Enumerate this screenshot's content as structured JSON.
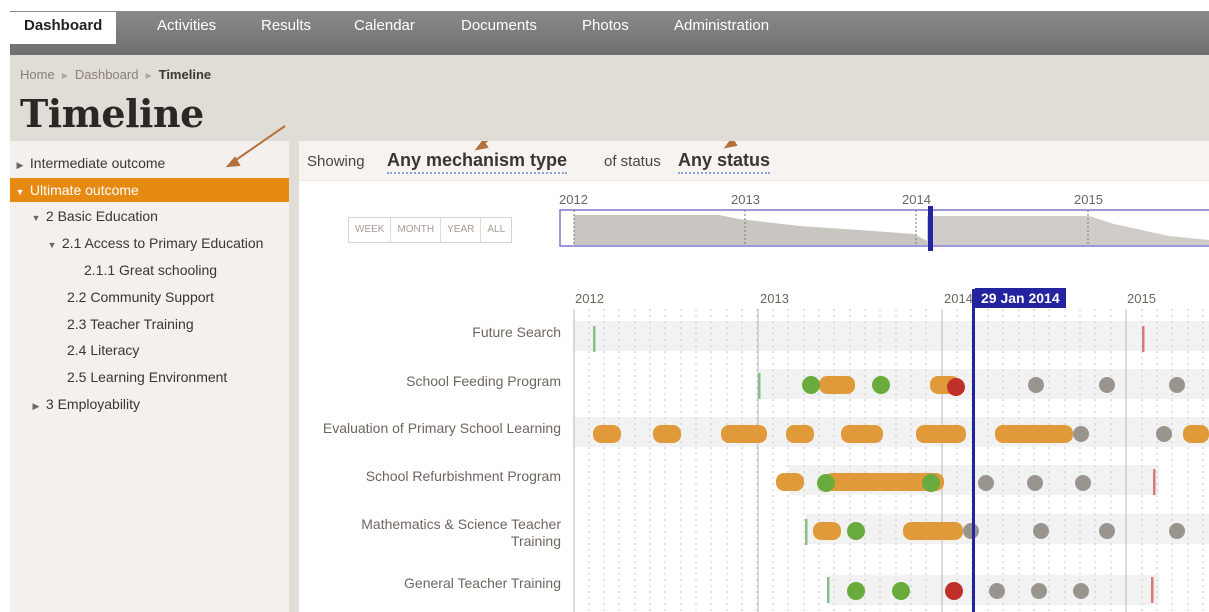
{
  "nav": {
    "tabs": [
      {
        "label": "Dashboard",
        "active": true
      },
      {
        "label": "Activities"
      },
      {
        "label": "Results"
      },
      {
        "label": "Calendar"
      },
      {
        "label": "Documents"
      },
      {
        "label": "Photos"
      },
      {
        "label": "Administration"
      }
    ]
  },
  "breadcrumb": {
    "home": "Home",
    "dashboard": "Dashboard",
    "current": "Timeline"
  },
  "page": {
    "title": "Timeline"
  },
  "sidebar": {
    "items": [
      {
        "label": "Intermediate outcome",
        "caret": "▶",
        "indent": 0
      },
      {
        "label": "Ultimate outcome",
        "caret": "▼",
        "indent": 0,
        "selected": true
      },
      {
        "label": "2 Basic Education",
        "caret": "▼",
        "indent": 1
      },
      {
        "label": "2.1 Access to Primary Education",
        "caret": "▼",
        "indent": 2
      },
      {
        "label": "2.1.1 Great schooling",
        "caret": "",
        "indent": 4
      },
      {
        "label": "2.2 Community Support",
        "caret": "",
        "indent": 3
      },
      {
        "label": "2.3 Teacher Training",
        "caret": "",
        "indent": 3
      },
      {
        "label": "2.4 Literacy",
        "caret": "",
        "indent": 3
      },
      {
        "label": "2.5 Learning Environment",
        "caret": "",
        "indent": 3
      },
      {
        "label": "3 Employability",
        "caret": "▶",
        "indent": 0
      }
    ]
  },
  "filter": {
    "showing_label": "Showing",
    "mechanism_value": "Any mechanism type",
    "of_status_label": "of status",
    "status_value": "Any status"
  },
  "range_buttons": [
    "WEEK",
    "MONTH",
    "YEAR",
    "ALL"
  ],
  "overview_years": [
    "2012",
    "2013",
    "2014",
    "2015"
  ],
  "main_years": [
    "2012",
    "2013",
    "2014",
    "2015"
  ],
  "current_date": "29 Jan 2014",
  "rows": [
    {
      "label": "Future Search",
      "lines": 1
    },
    {
      "label": "School Feeding Program",
      "lines": 1
    },
    {
      "label": "Evaluation of Primary School Learning",
      "lines": 1
    },
    {
      "label": "School Refurbishment Program",
      "lines": 1
    },
    {
      "label": "Mathematics & Science Teacher",
      "label2": "Training",
      "lines": 2
    },
    {
      "label": "General Teacher Training",
      "lines": 1
    }
  ],
  "colors": {
    "accent_orange": "#e68a12",
    "bar_orange": "#e09a3a",
    "success_green": "#6aab3e",
    "danger_red": "#c0302b",
    "pending_grey": "#9a948e",
    "marker_blue": "#2424a0",
    "start_green": "#88c088",
    "end_red": "#d77a7a"
  }
}
